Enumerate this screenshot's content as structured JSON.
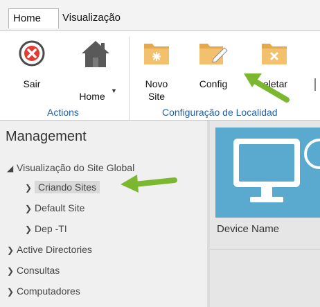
{
  "tabs": [
    {
      "label": "Home",
      "active": true
    },
    {
      "label": "Visualização",
      "active": false
    }
  ],
  "ribbon": {
    "buttons": [
      {
        "label": "Sair",
        "icon": "close-circle-icon"
      },
      {
        "label": "Home",
        "icon": "house-icon"
      },
      {
        "label": "Novo Site",
        "line1": "Novo",
        "line2": "Site",
        "icon": "new-folder-icon"
      },
      {
        "label": "Config",
        "icon": "edit-folder-icon"
      },
      {
        "label": "Deletar",
        "visible_text": "eletar",
        "icon": "delete-folder-icon"
      }
    ],
    "groups": [
      "Actions",
      "Configuração de Localidad"
    ]
  },
  "management": {
    "title": "Management",
    "tree": [
      {
        "label": "Visualização do Site Global",
        "expanded": true,
        "level": 0
      },
      {
        "label": "Criando Sites",
        "level": 1,
        "selected": true
      },
      {
        "label": "Default Site",
        "level": 1
      },
      {
        "label": "Dep -TI",
        "level": 1
      },
      {
        "label": "Active Directories",
        "level": 0
      },
      {
        "label": "Consultas",
        "level": 0
      },
      {
        "label": "Computadores",
        "level": 0
      }
    ]
  },
  "device_panel": {
    "column_label": "Device Name",
    "icon": "monitor-icon"
  },
  "colors": {
    "group_label": "#1f5fa8",
    "tile": "#5aa9cf",
    "annotation_arrow": "#7cb82f"
  }
}
